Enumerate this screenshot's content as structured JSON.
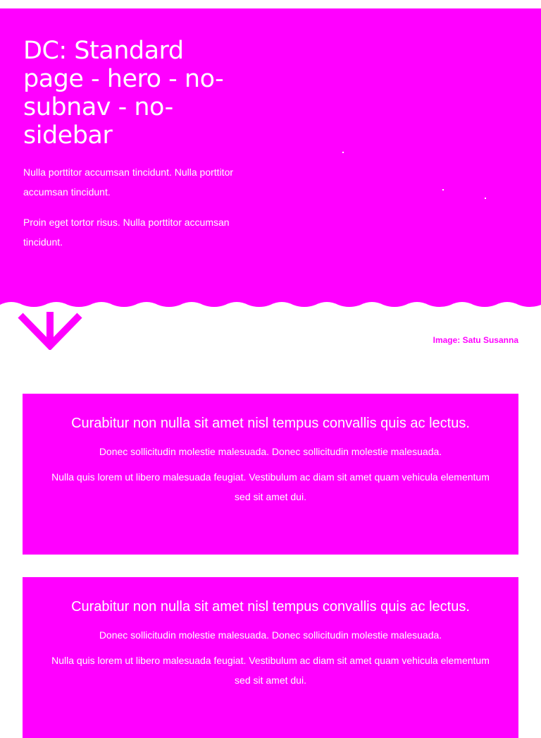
{
  "hero": {
    "title": "DC: Standard page - hero - no-subnav - no-sidebar",
    "paragraphs": [
      "Nulla porttitor accumsan tincidunt. Nulla porttitor accumsan tincidunt.",
      "Proin eget tortor risus. Nulla porttitor accumsan tincidunt."
    ],
    "image_credit": "Image: Satu Susanna"
  },
  "cards": [
    {
      "title": "Curabitur non nulla sit amet nisl tempus convallis quis ac lectus.",
      "paragraphs": [
        "Donec sollicitudin molestie malesuada. Donec sollicitudin molestie malesuada.",
        "Nulla quis lorem ut libero malesuada feugiat. Vestibulum ac diam sit amet quam vehicula elementum sed sit amet dui."
      ]
    },
    {
      "title": "Curabitur non nulla sit amet nisl tempus convallis quis ac lectus.",
      "paragraphs": [
        "Donec sollicitudin molestie malesuada. Donec sollicitudin molestie malesuada.",
        "Nulla quis lorem ut libero malesuada feugiat. Vestibulum ac diam sit amet quam vehicula elementum sed sit amet dui."
      ]
    }
  ],
  "colors": {
    "accent": "#ff00ff",
    "text_on_accent": "#ffffff",
    "background": "#ffffff"
  },
  "icons": {
    "scroll_down": "chevron-down-arrow-icon"
  }
}
